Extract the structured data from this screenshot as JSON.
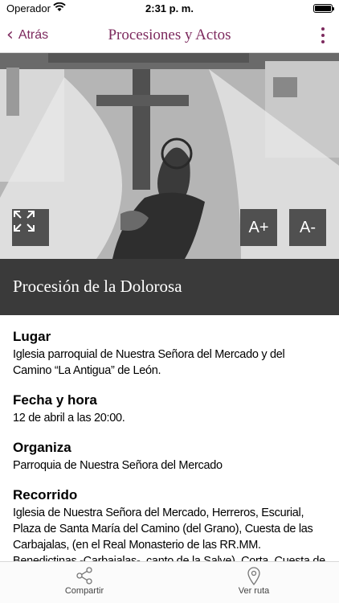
{
  "status_bar": {
    "carrier": "Operador",
    "time": "2:31 p. m."
  },
  "nav": {
    "back_label": "Atrás",
    "title": "Procesiones y Actos"
  },
  "hero": {
    "font_up_label": "A+",
    "font_down_label": "A-"
  },
  "event": {
    "title": "Procesión de la Dolorosa",
    "sections": [
      {
        "heading": "Lugar",
        "text": "Iglesia parroquial de Nuestra Señora del Mercado y del Camino “La Antigua” de León."
      },
      {
        "heading": "Fecha y hora",
        "text": "12 de abril a las 20:00."
      },
      {
        "heading": "Organiza",
        "text": "Parroquia de Nuestra Señora del Mercado"
      },
      {
        "heading": "Recorrido",
        "text": "Iglesia de Nuestra Señora del Mercado, Herreros, Escurial, Plaza de Santa María del Camino (del Grano), Cuesta de las Carbajalas, (en el Real Monasterio de las RR.MM. Benedictinas -Carbajalas-, canto de la Salve), Corta, Cuesta de los Castañones,"
      }
    ]
  },
  "toolbar": {
    "share_label": "Compartir",
    "route_label": "Ver ruta"
  },
  "colors": {
    "accent": "#7d2a5e",
    "title_band": "#3a3a3a"
  }
}
